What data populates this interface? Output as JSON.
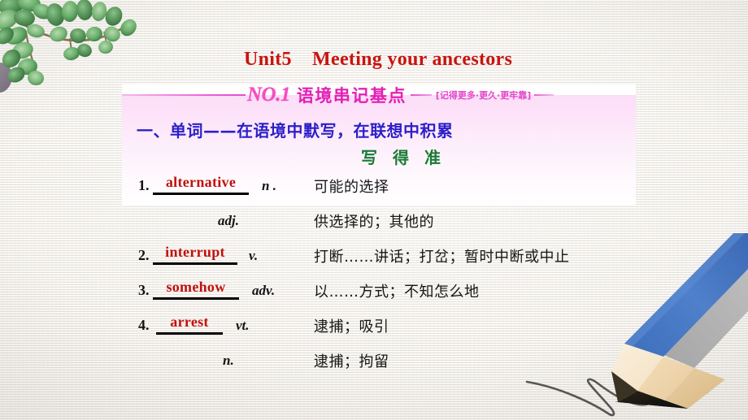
{
  "slide": {
    "title": "Unit5    Meeting your ancestors",
    "title_color": "#c8140f",
    "background_color": "#f0ede8"
  },
  "header_band": {
    "number_label": "NO.1",
    "band_title": "语境串记基点",
    "tagline": "[记得更多·更久·更牢靠]",
    "accent_color": "#e220b4",
    "number_color": "#f24fc0"
  },
  "section": {
    "heading": "一、单词——在语境中默写，在联想中积累",
    "heading_color": "#2c1fc8",
    "subheading": "写 得 准",
    "subheading_color": "#197a34"
  },
  "vocabulary": [
    {
      "number": "1.",
      "word": "alternative",
      "pos": "n .",
      "meaning": "可能的选择"
    },
    {
      "number": "",
      "word": "",
      "pos": "adj.",
      "meaning": "供选择的；其他的"
    },
    {
      "number": "2.",
      "word": "interrupt",
      "pos": "v.",
      "meaning": "打断……讲话；打岔；暂时中断或中止"
    },
    {
      "number": "3.",
      "word": "somehow",
      "pos": "adv.",
      "meaning": "以……方式；不知怎么地"
    },
    {
      "number": "4.",
      "word": "arrest",
      "pos": "vt.",
      "meaning": "逮捕；吸引"
    },
    {
      "number": "",
      "word": "",
      "pos": "n.",
      "meaning": "逮捕；拘留"
    }
  ],
  "decorations": {
    "plant": "watercolor-leaves-icon",
    "pencil": "blue-pencil-icon",
    "scribble": "pencil-scribble-line"
  },
  "colors": {
    "word_red": "#c0110c",
    "pink_panel_top": "#fbddf7",
    "pencil_blue": "#4a7cc4",
    "pencil_wood": "#f6e6cb",
    "leaf_green": "#55a05c"
  }
}
